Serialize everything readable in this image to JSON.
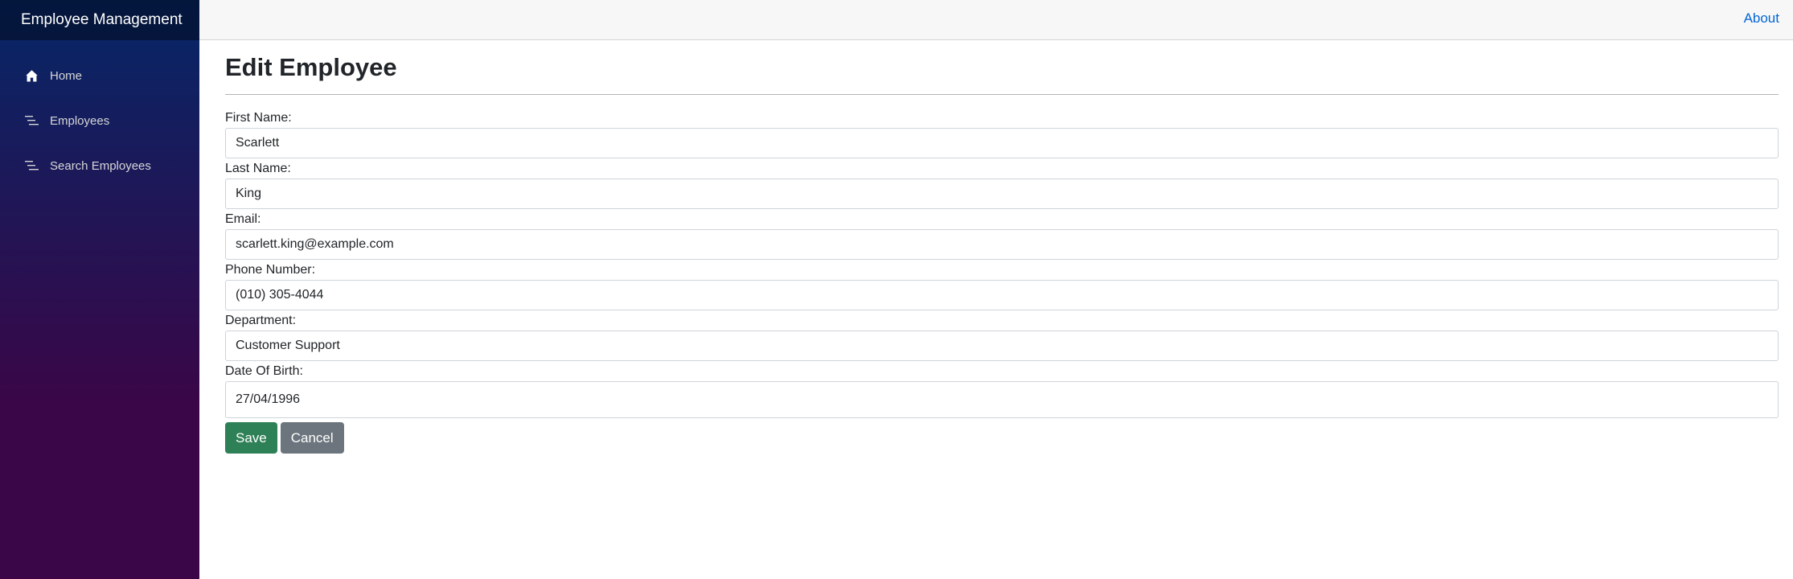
{
  "sidebar": {
    "brand": "Employee Management",
    "items": [
      {
        "label": "Home",
        "icon": "home-icon"
      },
      {
        "label": "Employees",
        "icon": "list-icon"
      },
      {
        "label": "Search Employees",
        "icon": "list-icon"
      }
    ]
  },
  "topbar": {
    "about_label": "About"
  },
  "page": {
    "title": "Edit Employee"
  },
  "form": {
    "first_name": {
      "label": "First Name:",
      "value": "Scarlett"
    },
    "last_name": {
      "label": "Last Name:",
      "value": "King"
    },
    "email": {
      "label": "Email:",
      "value": "scarlett.king@example.com"
    },
    "phone": {
      "label": "Phone Number:",
      "value": "(010) 305-4044"
    },
    "department": {
      "label": "Department:",
      "value": "Customer Support"
    },
    "dob": {
      "label": "Date Of Birth:",
      "value": "27/04/1996"
    },
    "save_label": "Save",
    "cancel_label": "Cancel"
  },
  "colors": {
    "save": "#2e8056",
    "cancel": "#6c757d",
    "link": "#0366d6"
  }
}
